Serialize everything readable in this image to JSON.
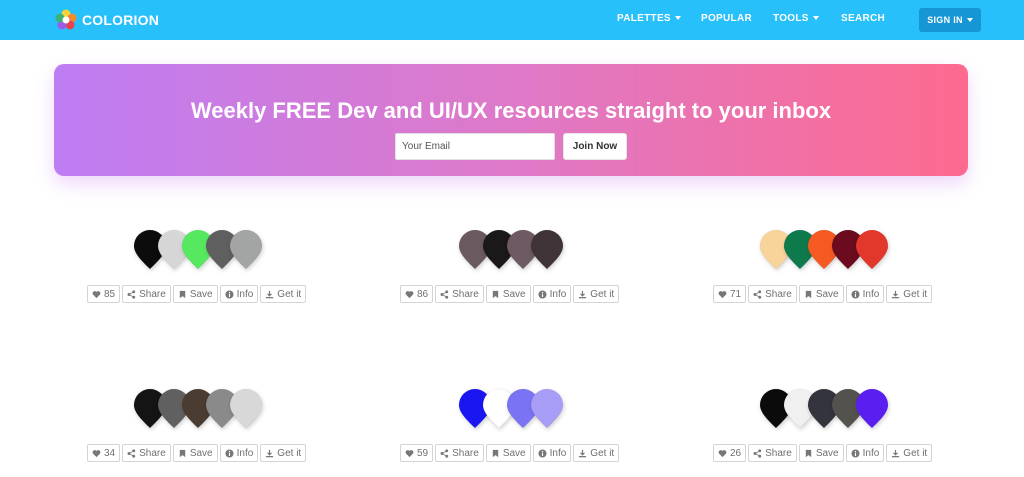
{
  "nav": {
    "brand": "COLORION",
    "links": [
      {
        "label": "PALETTES",
        "dropdown": true
      },
      {
        "label": "POPULAR",
        "dropdown": false
      },
      {
        "label": "TOOLS",
        "dropdown": true
      },
      {
        "label": "SEARCH",
        "dropdown": false
      }
    ],
    "signin": "SIGN IN"
  },
  "banner": {
    "title": "Weekly FREE Dev and UI/UX resources straight to your inbox",
    "email_placeholder": "Your Email",
    "join_label": "Join Now"
  },
  "actions": {
    "share": "Share",
    "save": "Save",
    "info": "Info",
    "get": "Get it"
  },
  "palettes": [
    {
      "likes": "85",
      "colors": [
        "#0c0c0c",
        "#d6d6d6",
        "#56e85f",
        "#5f5f5f",
        "#a2a5a3"
      ]
    },
    {
      "likes": "86",
      "colors": [
        "#6a5a60",
        "#1a1819",
        "#6e5a62",
        "#3f3337"
      ]
    },
    {
      "likes": "71",
      "colors": [
        "#f9d49a",
        "#0e7a4b",
        "#f55a23",
        "#6b0b1d",
        "#e1382b"
      ]
    },
    {
      "likes": "34",
      "colors": [
        "#141414",
        "#606060",
        "#4a3c30",
        "#8a8a8a",
        "#d8d8d8"
      ]
    },
    {
      "likes": "59",
      "colors": [
        "#1a16f2",
        "#ffffff",
        "#7a74f5",
        "#a79df6"
      ]
    },
    {
      "likes": "26",
      "colors": [
        "#0b0b0b",
        "#f0f0f0",
        "#34343e",
        "#54524e",
        "#5a1ef0"
      ]
    }
  ],
  "colors": {
    "navbar": "#27c0fb",
    "signin": "#1796d6",
    "banner_start": "#be7df3",
    "banner_end": "#fd6a8f"
  }
}
